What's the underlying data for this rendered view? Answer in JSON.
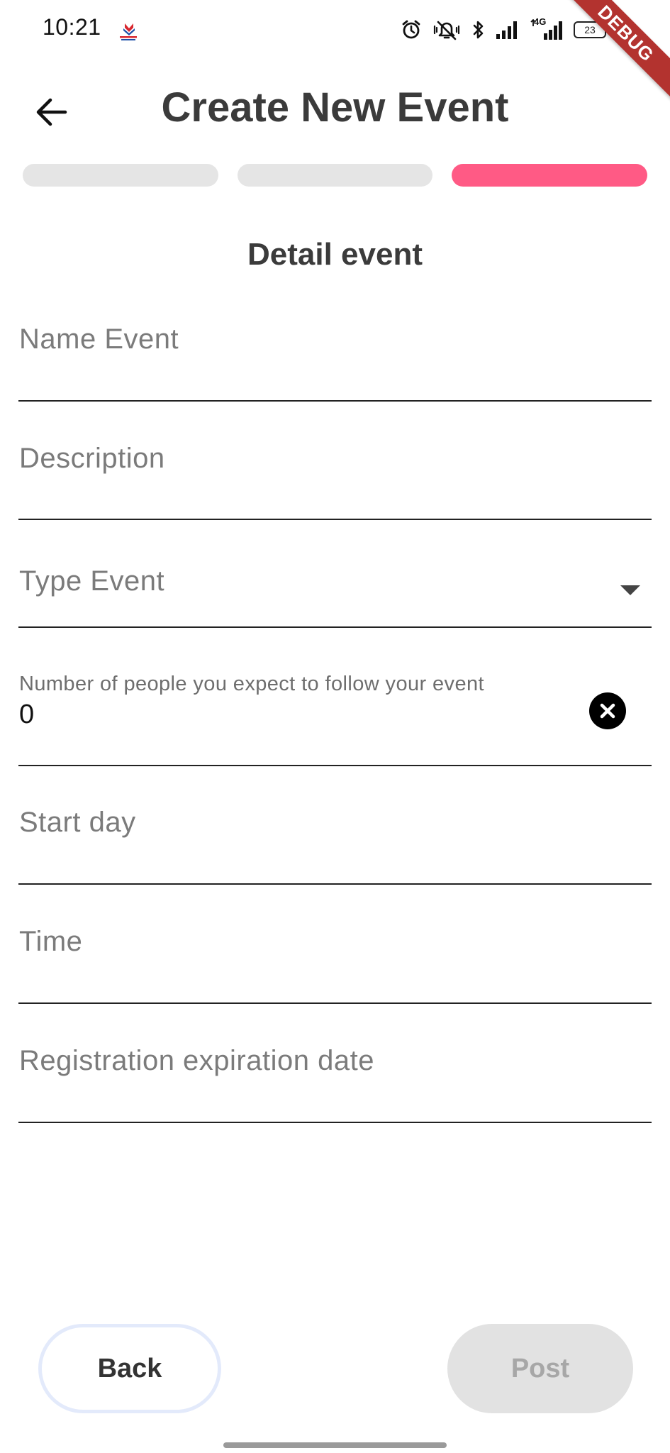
{
  "status_bar": {
    "time": "10:21",
    "network_label": "4G",
    "battery_level": "23",
    "icons": [
      "app-logo-icon",
      "alarm-icon",
      "vibrate-icon",
      "bluetooth-icon",
      "signal-icon",
      "signal-4g-icon",
      "battery-icon",
      "charging-icon"
    ]
  },
  "debug_banner": "DEBUG",
  "header": {
    "title": "Create New Event",
    "back_icon": "arrow-left-icon"
  },
  "steps": {
    "total": 3,
    "current": 3,
    "active_color": "#ff5a85",
    "inactive_color": "#e5e5e5"
  },
  "section": {
    "title": "Detail event"
  },
  "form": {
    "name_event": {
      "label": "Name Event",
      "value": ""
    },
    "description": {
      "label": "Description",
      "value": ""
    },
    "type_event": {
      "label": "Type Event",
      "value": "",
      "icon": "dropdown-arrow-icon"
    },
    "expected_people": {
      "label": "Number of people you expect to follow your event",
      "value": "0",
      "icon": "clear-icon"
    },
    "start_day": {
      "label": "Start day",
      "value": ""
    },
    "time": {
      "label": "Time",
      "value": ""
    },
    "registration_expiration": {
      "label": "Registration expiration date",
      "value": ""
    }
  },
  "buttons": {
    "back_label": "Back",
    "post_label": "Post"
  }
}
